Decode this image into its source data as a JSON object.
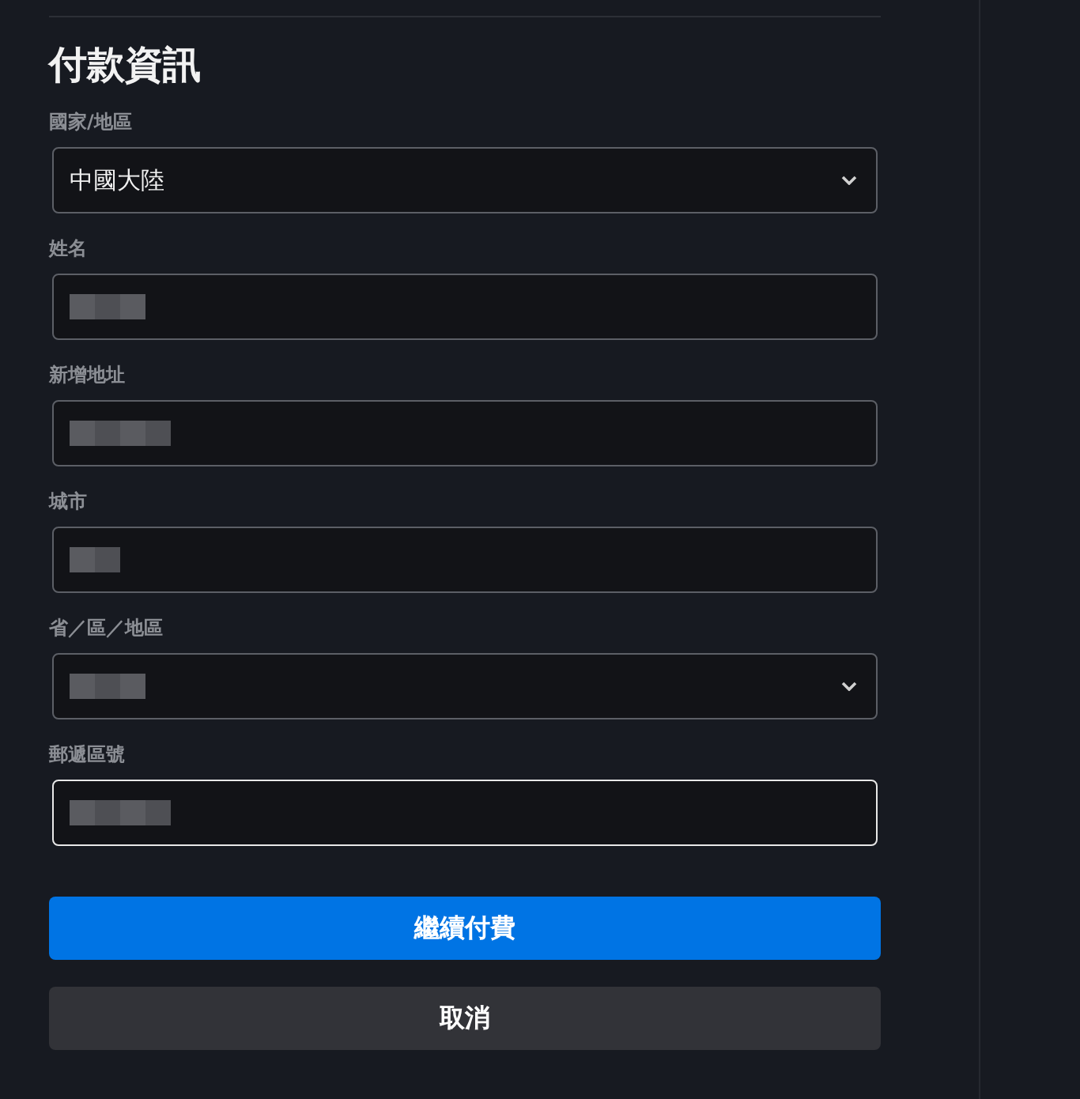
{
  "title": "付款資訊",
  "fields": [
    {
      "label": "國家/地區",
      "kind": "select",
      "value": "中國大陸",
      "focused": false
    },
    {
      "label": "姓名",
      "kind": "text",
      "redacted": true,
      "focused": false
    },
    {
      "label": "新增地址",
      "kind": "text",
      "redacted": true,
      "focused": false
    },
    {
      "label": "城市",
      "kind": "text",
      "redacted": true,
      "focused": false
    },
    {
      "label": "省／區／地區",
      "kind": "select",
      "redacted": true,
      "focused": false
    },
    {
      "label": "郵遞區號",
      "kind": "text",
      "redacted": true,
      "focused": true
    }
  ],
  "buttons": [
    {
      "label": "繼續付費",
      "kind": "primary"
    },
    {
      "label": "取消",
      "kind": "secondary"
    }
  ]
}
